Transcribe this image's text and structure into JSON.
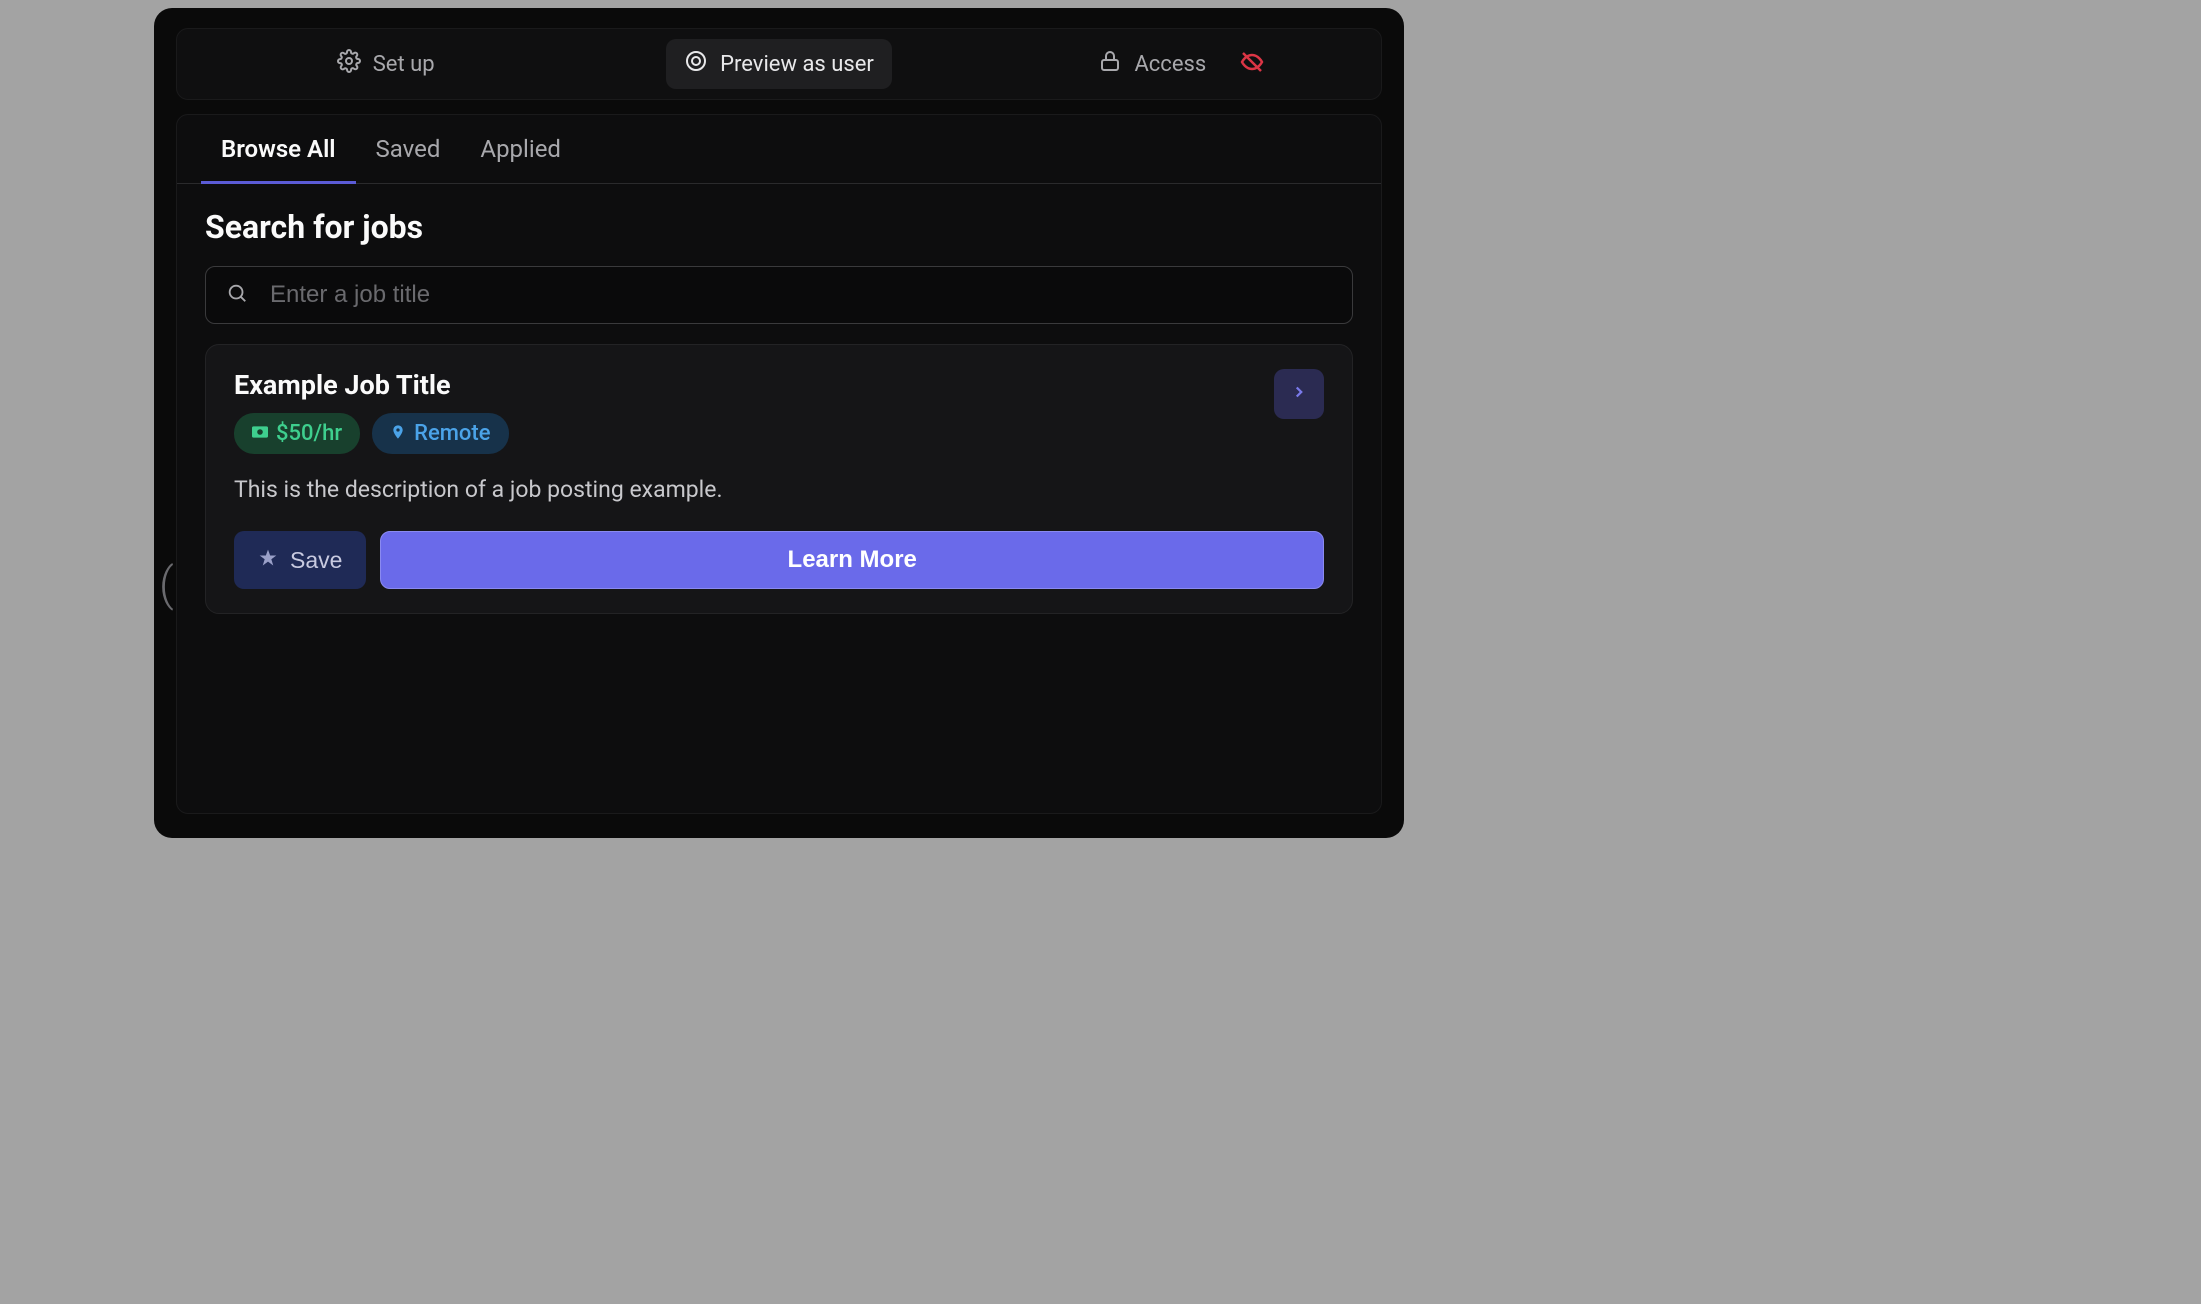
{
  "toolbar": {
    "setup_label": "Set up",
    "preview_label": "Preview as user",
    "access_label": "Access"
  },
  "tabs": {
    "browse_all": "Browse All",
    "saved": "Saved",
    "applied": "Applied"
  },
  "search": {
    "title": "Search for jobs",
    "placeholder": "Enter a job title"
  },
  "job": {
    "title": "Example Job Title",
    "rate": "$50/hr",
    "location": "Remote",
    "description": "This is the description of a job posting example.",
    "save_label": "Save",
    "learn_label": "Learn More"
  }
}
